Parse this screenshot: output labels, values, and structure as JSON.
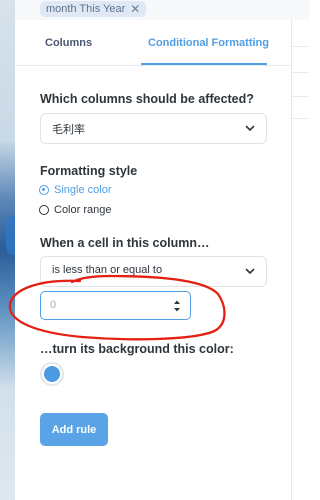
{
  "filter_chip": {
    "label": "month This Year",
    "close_glyph": "✕"
  },
  "tabs": {
    "columns": "Columns",
    "conditional_formatting": "Conditional Formatting"
  },
  "form": {
    "affected_columns_label": "Which columns should be affected?",
    "affected_column_value": "毛利率",
    "formatting_style_label": "Formatting style",
    "style_options": {
      "single_color": "Single color",
      "color_range": "Color range"
    },
    "selected_style": "single_color",
    "condition_label": "When a cell in this column…",
    "operator_value": "is less than or equal to",
    "threshold_value": "0",
    "background_color_label": "…turn its background this color:",
    "background_color": "#4b9ae2",
    "add_rule_label": "Add rule"
  },
  "colors": {
    "accent": "#509ee3",
    "annotation_red": "#e32012"
  },
  "icons": {
    "chevron": "chevron-down-icon",
    "stepper": "number-stepper-icon",
    "close": "close-icon"
  }
}
